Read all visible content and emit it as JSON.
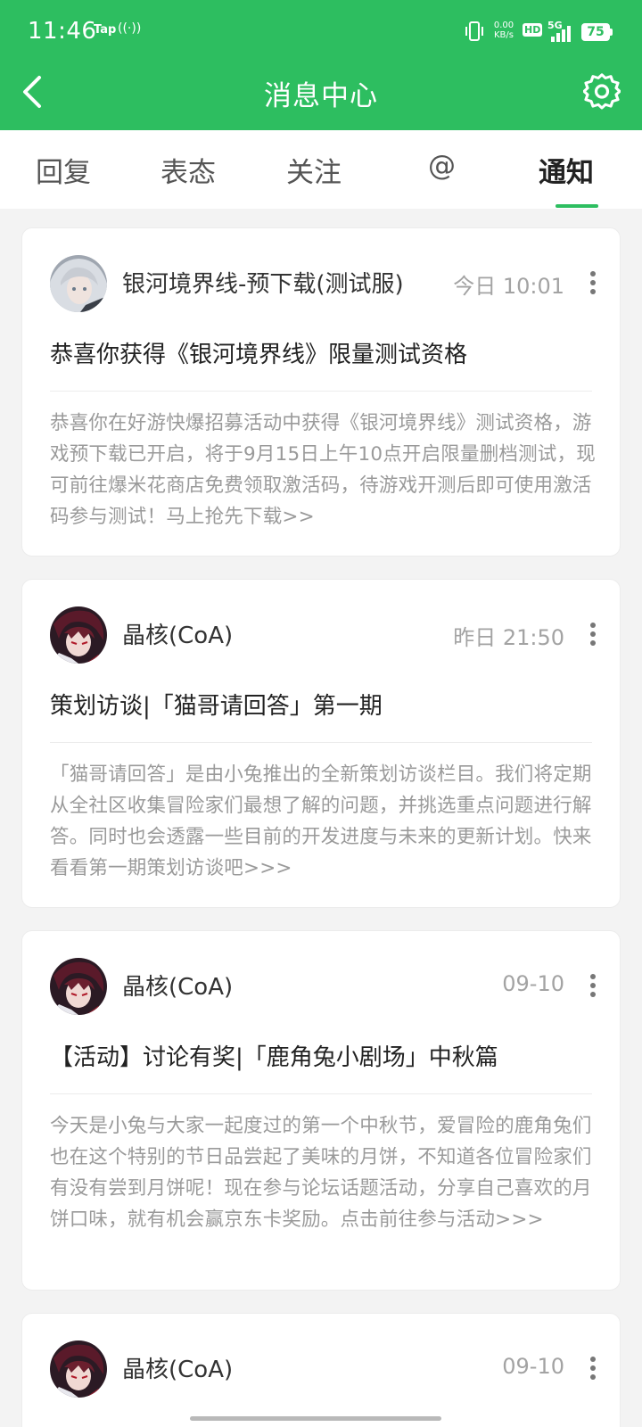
{
  "status_bar": {
    "time": "11:46",
    "app_badge": "Tap",
    "hotspot": "((·))",
    "net_speed_value": "0.00",
    "net_speed_unit": "KB/s",
    "hd": "HD",
    "network": "5G",
    "battery": "75"
  },
  "header": {
    "title": "消息中心",
    "back_icon": "chevron-left-icon",
    "settings_icon": "gear-icon"
  },
  "tabs": [
    {
      "label": "回复"
    },
    {
      "label": "表态"
    },
    {
      "label": "关注"
    },
    {
      "label": "@"
    },
    {
      "label": "通知",
      "active": true
    }
  ],
  "notifications": [
    {
      "author": "银河境界线-预下载(测试服)",
      "time": "今日 10:01",
      "title": "恭喜你获得《银河境界线》限量测试资格",
      "body": "恭喜你在好游快爆招募活动中获得《银河境界线》测试资格，游戏预下载已开启，将于9月15日上午10点开启限量删档测试，现可前往爆米花商店免费领取激活码，待游戏开测后即可使用激活码参与测试！马上抢先下载>>"
    },
    {
      "author": "晶核(CoA)",
      "time": "昨日 21:50",
      "title": "策划访谈|「猫哥请回答」第一期",
      "body": "「猫哥请回答」是由小兔推出的全新策划访谈栏目。我们将定期从全社区收集冒险家们最想了解的问题，并挑选重点问题进行解答。同时也会透露一些目前的开发进度与未来的更新计划。快来看看第一期策划访谈吧>>>"
    },
    {
      "author": "晶核(CoA)",
      "time": "09-10",
      "title": "【活动】讨论有奖|「鹿角兔小剧场」中秋篇",
      "body": "今天是小兔与大家一起度过的第一个中秋节，爱冒险的鹿角兔们也在这个特别的节日品尝起了美味的月饼，不知道各位冒险家们有没有尝到月饼呢！现在参与论坛话题活动，分享自己喜欢的月饼口味，就有机会赢京东卡奖励。点击前往参与活动>>>"
    },
    {
      "author": "晶核(CoA)",
      "time": "09-10",
      "title": "",
      "body": ""
    }
  ],
  "colors": {
    "brand_green": "#2dbe60",
    "page_bg": "#f3f3f3",
    "muted_text": "#9a9a9a"
  }
}
